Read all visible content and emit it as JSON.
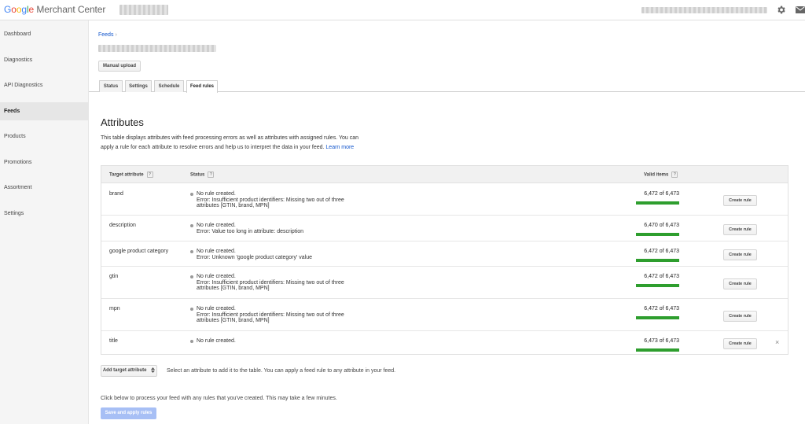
{
  "app": {
    "logo_google": [
      "G",
      "o",
      "o",
      "g",
      "l",
      "e"
    ],
    "logo_product": "Merchant Center"
  },
  "sidebar": {
    "items": [
      {
        "label": "Dashboard"
      },
      {
        "label": "Diagnostics"
      },
      {
        "label": "API Diagnostics"
      },
      {
        "label": "Feeds",
        "active": true
      },
      {
        "label": "Products"
      },
      {
        "label": "Promotions"
      },
      {
        "label": "Assortment"
      },
      {
        "label": "Settings"
      }
    ]
  },
  "header": {
    "breadcrumb": "Feeds",
    "breadcrumb_sep": "›",
    "manual_upload": "Manual upload"
  },
  "tabs": [
    {
      "label": "Status"
    },
    {
      "label": "Settings"
    },
    {
      "label": "Schedule"
    },
    {
      "label": "Feed rules",
      "active": true
    }
  ],
  "main": {
    "title": "Attributes",
    "description": "This table displays attributes with feed processing errors as well as attributes with assigned rules. You can apply a rule for each attribute to resolve errors and help us to interpret the data in your feed.",
    "learn_more": "Learn more"
  },
  "table": {
    "headers": {
      "attribute": "Target attribute",
      "status": "Status",
      "valid": "Valid items",
      "help": "?"
    },
    "create_rule_label": "Create rule",
    "remove_label": "×",
    "rows": [
      {
        "attribute": "brand",
        "status": [
          "No rule created.",
          "Error: Insufficient product identifiers: Missing two out of three",
          "attributes [GTIN, brand, MPN]"
        ],
        "valid": "6,472 of 6,473",
        "valid_fraction": 0.9998
      },
      {
        "attribute": "description",
        "status": [
          "No rule created.",
          "Error: Value too long in attribute: description"
        ],
        "valid": "6,470 of 6,473",
        "valid_fraction": 0.9995
      },
      {
        "attribute": "google product category",
        "status": [
          "No rule created.",
          "Error: Unknown 'google product category' value"
        ],
        "valid": "6,472 of 6,473",
        "valid_fraction": 0.9998
      },
      {
        "attribute": "gtin",
        "status": [
          "No rule created.",
          "Error: Insufficient product identifiers: Missing two out of three",
          "attributes [GTIN, brand, MPN]"
        ],
        "valid": "6,472 of 6,473",
        "valid_fraction": 0.9998
      },
      {
        "attribute": "mpn",
        "status": [
          "No rule created.",
          "Error: Insufficient product identifiers: Missing two out of three",
          "attributes [GTIN, brand, MPN]"
        ],
        "valid": "6,472 of 6,473",
        "valid_fraction": 0.9998
      },
      {
        "attribute": "title",
        "status": [
          "No rule created."
        ],
        "valid": "6,473 of 6,473",
        "valid_fraction": 1.0,
        "removable": true
      }
    ]
  },
  "footer": {
    "add_target_attribute": "Add target attribute",
    "add_hint": "Select an attribute to add it to the table. You can apply a feed rule to any attribute in your feed.",
    "process_text": "Click below to process your feed with any rules that you've created. This may take a few minutes.",
    "save_apply": "Save and apply rules"
  },
  "colors": {
    "link": "#1155cc",
    "valid_bar": "#2e9e2e",
    "save_button_disabled": "#a7bff5"
  }
}
